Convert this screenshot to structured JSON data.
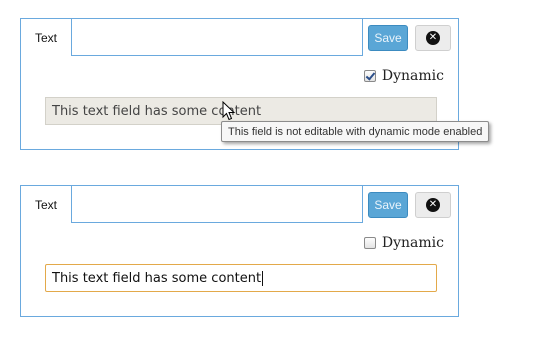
{
  "panels": [
    {
      "tab_label": "Text",
      "save_label": "Save",
      "dynamic_label": "Dynamic",
      "dynamic_checked": true,
      "field_value": "This text field has some content",
      "field_editable": false,
      "tooltip": "This field is not editable with dynamic mode enabled"
    },
    {
      "tab_label": "Text",
      "save_label": "Save",
      "dynamic_label": "Dynamic",
      "dynamic_checked": false,
      "field_value": "This text field has some content",
      "field_editable": true
    }
  ],
  "icons": {
    "close": "close-icon",
    "cursor": "mouse-pointer-icon"
  },
  "colors": {
    "panel_border": "#6aa9de",
    "save_button": "#5aa6d6",
    "focus_border": "#e3a94a",
    "disabled_field": "#eceae4"
  }
}
